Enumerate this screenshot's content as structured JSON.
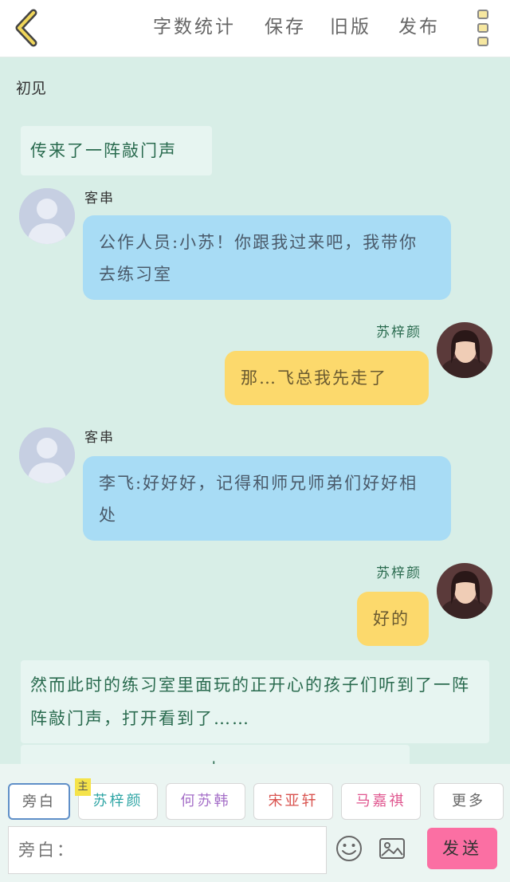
{
  "header": {
    "back_icon": "chevron-left-icon",
    "word_count": "字数统计",
    "save": "保存",
    "old_version": "旧版",
    "publish": "发布",
    "more_icon": "more-vertical-icon"
  },
  "chapter_title": "初见",
  "messages": [
    {
      "type": "narration",
      "text": "传来了一阵敲门声"
    },
    {
      "type": "left",
      "name": "客串",
      "text": "公作人员:小苏！你跟我过来吧，我带你去练习室"
    },
    {
      "type": "right",
      "name": "苏梓颜",
      "text": "那…飞总我先走了"
    },
    {
      "type": "left",
      "name": "客串",
      "text": "李飞:好好好，记得和师兄师弟们好好相处"
    },
    {
      "type": "right",
      "name": "苏梓颜",
      "text": "好的"
    },
    {
      "type": "narration",
      "text": "然而此时的练习室里面玩的正开心的孩子们听到了一阵阵敲门声，打开看到了……"
    },
    {
      "type": "narration",
      "text": "上"
    }
  ],
  "roles": [
    {
      "label": "旁白",
      "color": "#666666"
    },
    {
      "label": "苏梓颜",
      "color": "#2fa5a5",
      "badge": "主"
    },
    {
      "label": "何苏韩",
      "color": "#a56fc8"
    },
    {
      "label": "宋亚轩",
      "color": "#d9534f"
    },
    {
      "label": "马嘉祺",
      "color": "#e0568f"
    },
    {
      "label": "更多",
      "color": "#666666"
    }
  ],
  "input": {
    "placeholder": "旁白："
  },
  "send_label": "发送",
  "colors": {
    "bubble_blue": "#a8dcf5",
    "bubble_yellow": "#fcd96c",
    "send": "#fb6fa3",
    "background": "#d8eee7"
  }
}
